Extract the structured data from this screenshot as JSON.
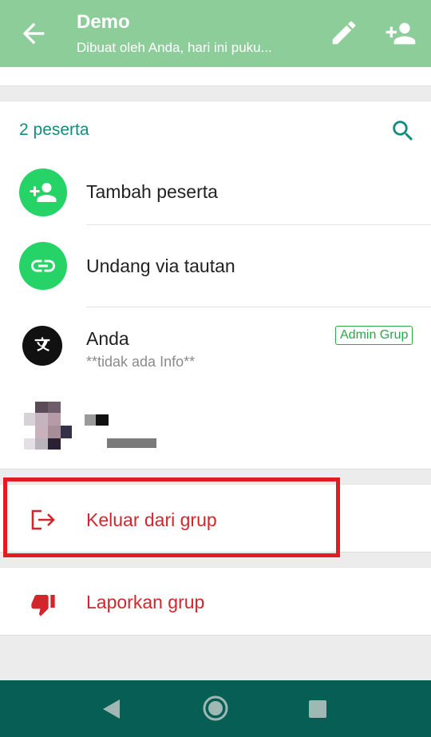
{
  "header": {
    "title": "Demo",
    "subtitle": "Dibuat oleh Anda, hari ini puku..."
  },
  "participants": {
    "count_label": "2 peserta",
    "add_label": "Tambah peserta",
    "invite_label": "Undang via tautan",
    "members": [
      {
        "name": "Anda",
        "about": "**tidak ada Info**",
        "badge": "Admin Grup"
      }
    ]
  },
  "actions": {
    "leave_label": "Keluar dari grup",
    "report_label": "Laporkan grup"
  },
  "colors": {
    "appbar": "#8ccd9a",
    "accent_teal": "#128c7e",
    "green": "#25d366",
    "danger": "#d3262c",
    "highlight": "#e31b23",
    "navbar": "#075e54"
  },
  "icons": {
    "back": "arrow-left-icon",
    "edit": "pencil-icon",
    "add_participant": "person-add-icon",
    "search": "search-icon",
    "link": "link-icon",
    "exit": "exit-icon",
    "report": "thumb-down-icon"
  }
}
